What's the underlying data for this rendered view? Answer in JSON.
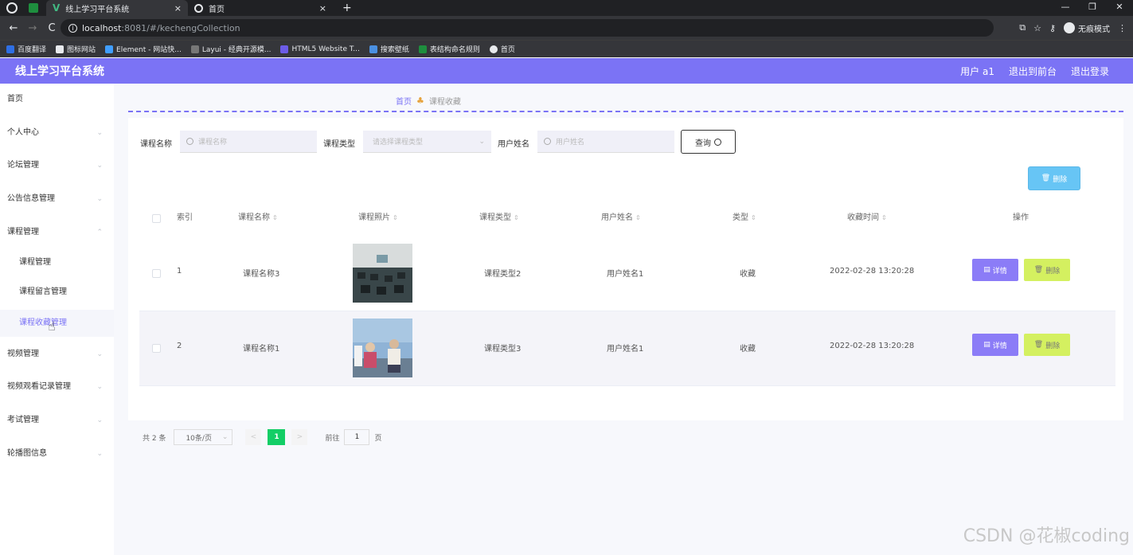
{
  "browser": {
    "tabs": [
      {
        "title": "线上学习平台系统",
        "close": "×"
      },
      {
        "title": "首页",
        "close": "×"
      }
    ],
    "new_tab": "+",
    "window_controls": [
      "—",
      "❐",
      "✕"
    ],
    "nav": {
      "back": "←",
      "forward": "→",
      "reload": "C"
    },
    "url_host": "localhost",
    "url_path": ":8081/#/kechengCollection",
    "incognito_label": "无痕模式",
    "bookmarks": [
      {
        "label": "百度翻译",
        "color": "#2f6fe4"
      },
      {
        "label": "图标网站",
        "color": "#ffffff"
      },
      {
        "label": "Element - 网站快...",
        "color": "#409eff"
      },
      {
        "label": "Layui - 经典开源模...",
        "color": "#999999"
      },
      {
        "label": "HTML5 Website T...",
        "color": "#6c5ce7"
      },
      {
        "label": "搜索壁纸",
        "color": "#4a90e2"
      },
      {
        "label": "表结构命名规则",
        "color": "#1e8e3e"
      },
      {
        "label": "首页",
        "color": "#e8eaed"
      }
    ]
  },
  "header": {
    "title": "线上学习平台系统",
    "user": "用户 a1",
    "back_front": "退出到前台",
    "logout": "退出登录",
    "accent": "#7b73f5"
  },
  "sidebar": {
    "items": [
      {
        "label": "首页",
        "arrow": ""
      },
      {
        "label": "个人中心",
        "arrow": "⌄"
      },
      {
        "label": "论坛管理",
        "arrow": "⌄"
      },
      {
        "label": "公告信息管理",
        "arrow": "⌄"
      },
      {
        "label": "课程管理",
        "arrow": "⌃"
      },
      {
        "label": "课程管理",
        "arrow": ""
      },
      {
        "label": "课程留言管理",
        "arrow": ""
      },
      {
        "label": "课程收藏管理",
        "arrow": ""
      },
      {
        "label": "视频管理",
        "arrow": "⌄"
      },
      {
        "label": "视频观看记录管理",
        "arrow": "⌄"
      },
      {
        "label": "考试管理",
        "arrow": "⌄"
      },
      {
        "label": "轮播图信息",
        "arrow": "⌄"
      }
    ]
  },
  "breadcrumb": {
    "home": "首页",
    "current": "课程收藏"
  },
  "search": {
    "course_name_label": "课程名称",
    "course_name_placeholder": "课程名称",
    "course_type_label": "课程类型",
    "course_type_placeholder": "请选择课程类型",
    "user_name_label": "用户姓名",
    "user_name_placeholder": "用户姓名",
    "query_button": "查询"
  },
  "toolbar": {
    "delete_button": "删除"
  },
  "table": {
    "columns": [
      "索引",
      "课程名称",
      "课程照片",
      "课程类型",
      "用户姓名",
      "类型",
      "收藏时间",
      "操作"
    ],
    "rows": [
      {
        "index": "1",
        "name": "课程名称3",
        "type": "课程类型2",
        "user": "用户姓名1",
        "kind": "收藏",
        "time": "2022-02-28 13:20:28",
        "detail": "详情",
        "delete": "删除"
      },
      {
        "index": "2",
        "name": "课程名称1",
        "type": "课程类型3",
        "user": "用户姓名1",
        "kind": "收藏",
        "time": "2022-02-28 13:20:28",
        "detail": "详情",
        "delete": "删除"
      }
    ]
  },
  "pagination": {
    "total": "共 2 条",
    "page_size": "10条/页",
    "prev": "<",
    "current_page": "1",
    "next": ">",
    "goto_label": "前往",
    "goto_value": "1",
    "page_suffix": "页"
  },
  "watermark": "CSDN @花椒coding"
}
